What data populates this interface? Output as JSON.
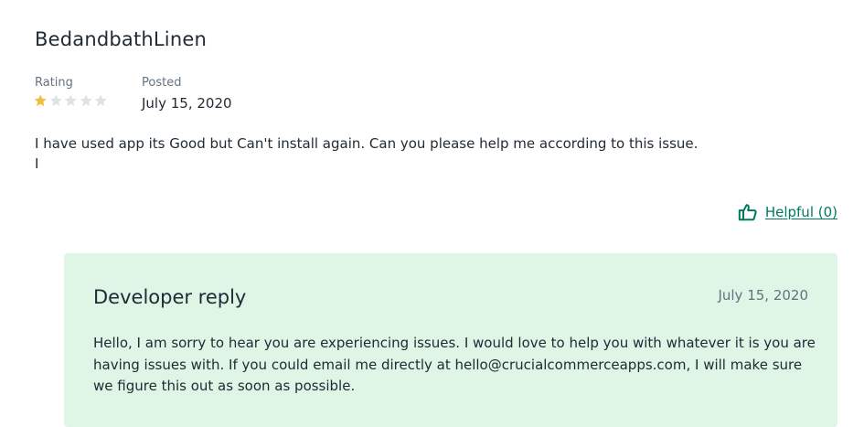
{
  "review": {
    "reviewer_name": "BedandbathLinen",
    "rating_label": "Rating",
    "rating_value": 1,
    "rating_max": 5,
    "posted_label": "Posted",
    "posted_date": "July 15, 2020",
    "body_line1": "I have used app its Good but Can't install again. Can you please help me according to this issue.",
    "body_line2": "I",
    "helpful_label": "Helpful (0)"
  },
  "developer_reply": {
    "title": "Developer reply",
    "date": "July 15, 2020",
    "body": "Hello, I am sorry to hear you are experiencing issues. I would love to help you with whatever it is you are having issues with. If you could email me directly at hello@crucialcommerceapps.com, I will make sure we figure this out as soon as possible."
  },
  "colors": {
    "star_filled": "#f4bd40",
    "star_empty": "#dfe3e8",
    "link": "#007a5a",
    "reply_background": "#dff5e6"
  },
  "icons": {
    "star": "star-icon",
    "helpful": "thumbs-up-icon"
  }
}
